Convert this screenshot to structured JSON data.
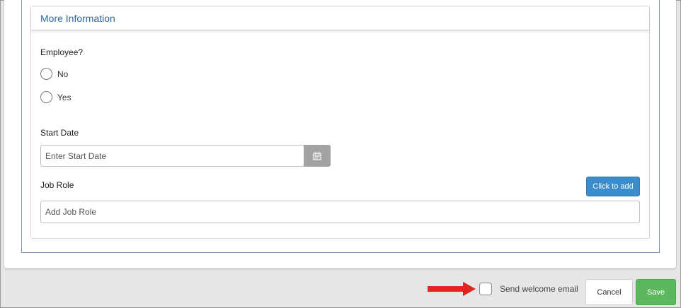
{
  "section": {
    "title": "More Information"
  },
  "employee": {
    "label": "Employee?",
    "options": [
      {
        "label": "No",
        "selected": false
      },
      {
        "label": "Yes",
        "selected": false
      }
    ]
  },
  "start_date": {
    "label": "Start Date",
    "placeholder": "Enter Start Date",
    "value": "",
    "icon": "calendar-icon"
  },
  "job_role": {
    "label": "Job Role",
    "add_button_label": "Click to add",
    "placeholder": "Add Job Role",
    "value": ""
  },
  "footer": {
    "annotation_icon": "red-arrow-icon",
    "welcome_email_label": "Send welcome email",
    "welcome_email_checked": false,
    "cancel_label": "Cancel",
    "save_label": "Save"
  },
  "colors": {
    "accent": "#3c8dcd",
    "title": "#2a6aa8",
    "save": "#5cb85c",
    "arrow": "#e0261f"
  }
}
